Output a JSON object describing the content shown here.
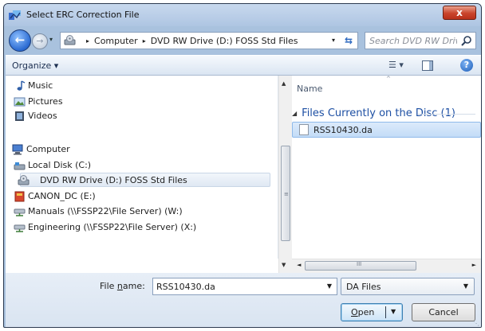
{
  "window": {
    "title": "Select ERC Correction File",
    "close_label": "x"
  },
  "nav": {
    "back_glyph": "←",
    "forward_glyph": "→",
    "history_glyph": "▾"
  },
  "address": {
    "breadcrumbs": [
      "Computer",
      "DVD RW Drive (D:) FOSS Std Files"
    ],
    "separator": "▸",
    "dropdown_glyph": "▾",
    "refresh_glyph": "⇆"
  },
  "search": {
    "placeholder": "Search DVD RW Drive (... "
  },
  "toolbar": {
    "organize_label": "Organize ▾",
    "view_label": "☰ ▾",
    "help_label": "?"
  },
  "sidebar": {
    "items": [
      {
        "label": "Music",
        "icon": "music-icon"
      },
      {
        "label": "Pictures",
        "icon": "pictures-icon"
      },
      {
        "label": "Videos",
        "icon": "videos-icon"
      },
      {
        "label": "Computer",
        "icon": "computer-icon"
      },
      {
        "label": "Local Disk (C:)",
        "icon": "local-disk-icon"
      },
      {
        "label": "DVD RW Drive (D:) FOSS Std Files",
        "icon": "dvd-drive-icon",
        "selected": true
      },
      {
        "label": "CANON_DC (E:)",
        "icon": "removable-drive-icon"
      },
      {
        "label": "Manuals (\\\\FSSP22\\File Server) (W:)",
        "icon": "network-drive-icon"
      },
      {
        "label": "Engineering (\\\\FSSP22\\File Server) (X:)",
        "icon": "network-drive-icon"
      }
    ]
  },
  "files": {
    "column_name": "Name",
    "group_label": "Files Currently on the Disc (1)",
    "items": [
      {
        "name": "RSS10430.da",
        "selected": true
      }
    ]
  },
  "scroll": {
    "up": "▲",
    "down": "▼",
    "left": "◄",
    "right": "►",
    "grip": "≡",
    "hgrip": "III"
  },
  "footer": {
    "file_name_label_prefix": "File ",
    "file_name_label_underlined": "n",
    "file_name_label_suffix": "ame:",
    "file_name_value": "RSS10430.da",
    "file_type": "DA Files",
    "open_label_underlined": "O",
    "open_label_rest": "pen",
    "cancel_label": "Cancel",
    "drop_glyph": "▼"
  },
  "colors": {
    "selection": "#cce4f7",
    "group_header": "#1d4fa3",
    "close": "#c9442b"
  }
}
